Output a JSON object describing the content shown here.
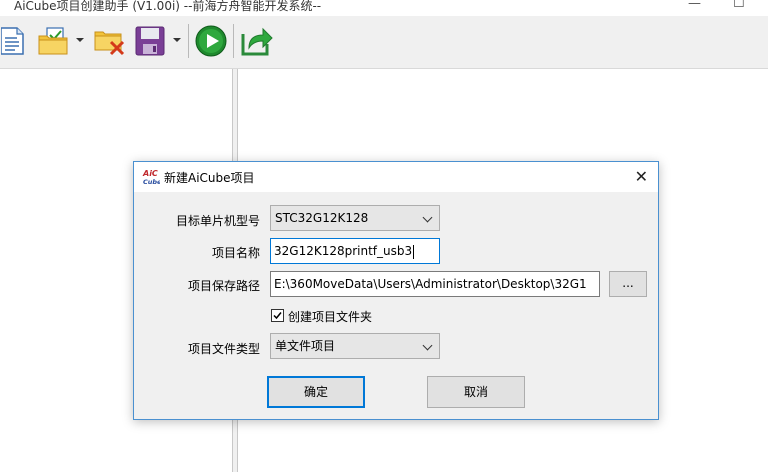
{
  "window": {
    "title": "AiCube项目创建助手 (V1.00i) --前海方舟智能开发系统--"
  },
  "toolbar": {
    "icons": [
      "new-document-icon",
      "open-project-icon",
      "close-project-icon",
      "save-icon",
      "run-icon",
      "export-icon"
    ]
  },
  "dialog": {
    "title": "新建AiCube项目",
    "logo_text_top": "AiC",
    "logo_text_bottom": "Cube",
    "mcu_label": "目标单片机型号",
    "mcu_value": "STC32G12K128",
    "name_label": "项目名称",
    "name_value": "32G12K128printf_usb3",
    "path_label": "项目保存路径",
    "path_value": "E:\\360MoveData\\Users\\Administrator\\Desktop\\32G1",
    "browse_label": "...",
    "create_folder_label": "创建项目文件夹",
    "create_folder_checked": true,
    "type_label": "项目文件类型",
    "type_value": "单文件项目",
    "ok_label": "确定",
    "cancel_label": "取消"
  }
}
